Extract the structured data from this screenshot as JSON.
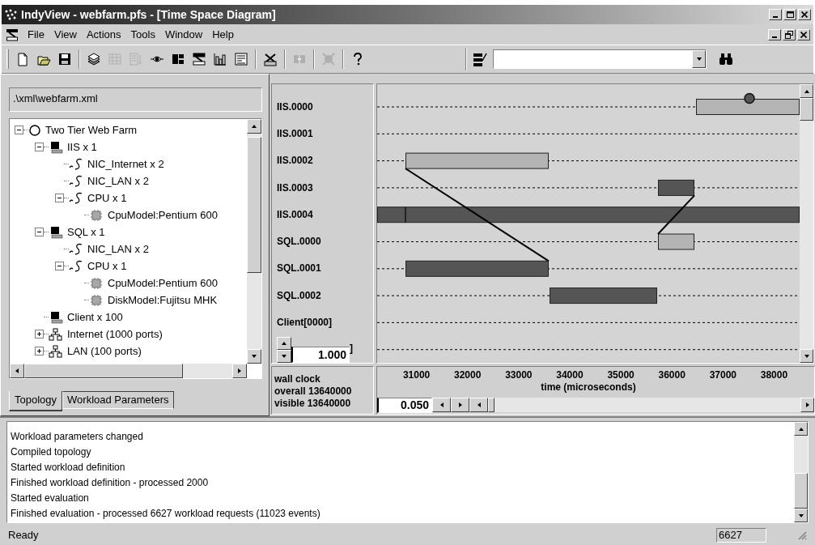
{
  "window": {
    "title": "IndyView - webfarm.pfs - [Time Space Diagram]"
  },
  "menu": [
    "File",
    "View",
    "Actions",
    "Tools",
    "Window",
    "Help"
  ],
  "toolbar": [
    {
      "kind": "new",
      "disabled": false
    },
    {
      "kind": "open",
      "disabled": false
    },
    {
      "kind": "save",
      "disabled": false
    },
    {
      "kind": "separator"
    },
    {
      "kind": "stack",
      "disabled": false
    },
    {
      "kind": "grid",
      "disabled": true
    },
    {
      "kind": "list",
      "disabled": true
    },
    {
      "kind": "eye",
      "disabled": false
    },
    {
      "kind": "blocks",
      "disabled": false
    },
    {
      "kind": "diagram",
      "disabled": false
    },
    {
      "kind": "bars",
      "disabled": false
    },
    {
      "kind": "form",
      "disabled": false
    },
    {
      "kind": "separator"
    },
    {
      "kind": "scale",
      "disabled": false
    },
    {
      "kind": "separator"
    },
    {
      "kind": "link",
      "disabled": true
    },
    {
      "kind": "separator"
    },
    {
      "kind": "gear",
      "disabled": true
    },
    {
      "kind": "separator"
    },
    {
      "kind": "help",
      "disabled": false
    }
  ],
  "path_field": {
    "value": ".\\xml\\webfarm.xml"
  },
  "tree": [
    {
      "label": "Two Tier Web Farm",
      "kind": "system",
      "expanded": true,
      "children": [
        {
          "label": "IIS x 1",
          "kind": "computer",
          "expanded": true,
          "children": [
            {
              "label": "NIC_Internet x 2",
              "kind": "wave"
            },
            {
              "label": "NIC_LAN x 2",
              "kind": "wave"
            },
            {
              "label": "CPU x 1",
              "kind": "wave",
              "expanded": true,
              "children": [
                {
                  "label": "CpuModel:Pentium 600",
                  "kind": "chip"
                }
              ]
            }
          ]
        },
        {
          "label": "SQL x 1",
          "kind": "computer",
          "expanded": true,
          "children": [
            {
              "label": "NIC_LAN x 2",
              "kind": "wave"
            },
            {
              "label": "CPU x 1",
              "kind": "wave",
              "expanded": true,
              "children": [
                {
                  "label": "CpuModel:Pentium 600",
                  "kind": "chip"
                },
                {
                  "label": "DiskModel:Fujitsu MHK",
                  "kind": "chip"
                }
              ]
            }
          ]
        },
        {
          "label": "Client x 100",
          "kind": "computer"
        },
        {
          "label": "Internet (1000 ports)",
          "kind": "network",
          "expanded": false
        },
        {
          "label": "LAN (100 ports)",
          "kind": "network",
          "expanded": false
        }
      ]
    }
  ],
  "left_tabs": [
    {
      "label": "Topology",
      "selected": true
    },
    {
      "label": "Workload Parameters",
      "selected": false
    }
  ],
  "diagram": {
    "zoom_value": "1.000",
    "scale_value": "0.050",
    "clock": [
      "wall clock",
      "overall 13640000",
      "visible 13640000"
    ],
    "axis_title": "time (microseconds)",
    "ticks": [
      "31000",
      "32000",
      "33000",
      "34000",
      "35000",
      "36000",
      "37000",
      "38000"
    ],
    "lanes": [
      "IIS.0000",
      "IIS.0001",
      "IIS.0002",
      "IIS.0003",
      "IIS.0004",
      "SQL.0000",
      "SQL.0001",
      "SQL.0002",
      "Client[0000]",
      "]"
    ]
  },
  "log": [
    "Workload parameters changed",
    "Compiled topology",
    "Started workload definition",
    "Finished workload definition - processed 2000",
    "Started evaluation",
    "Finished evaluation - processed 6627 workload requests (11023 events)"
  ],
  "status_bar": {
    "text": "Ready",
    "count": "6627"
  }
}
